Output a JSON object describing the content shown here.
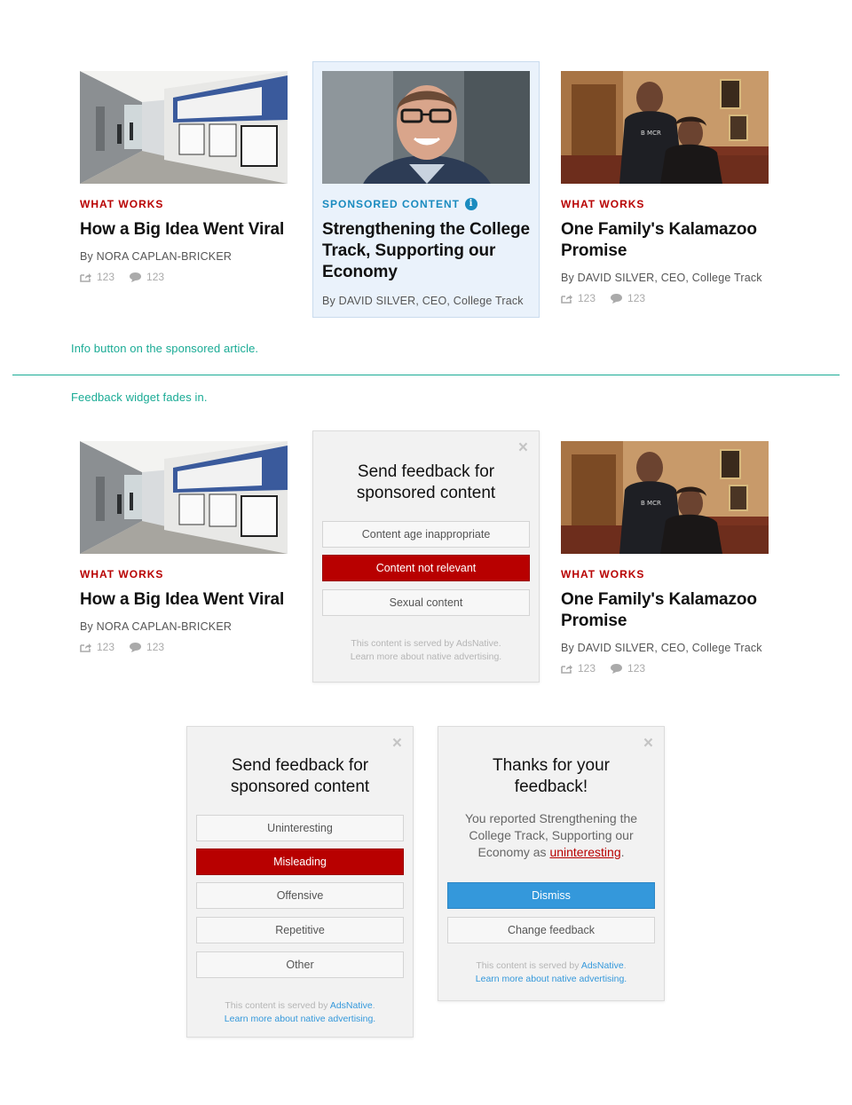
{
  "notes": {
    "info": "Info button on the sponsored article.",
    "feedback": "Feedback widget fades in."
  },
  "articles": {
    "left": {
      "kicker": "WHAT WORKS",
      "headline": "How a Big Idea Went Viral",
      "byline": "By NORA CAPLAN-BRICKER",
      "shares": "123",
      "comments": "123"
    },
    "sponsored": {
      "kicker": "SPONSORED CONTENT",
      "headline": "Strengthening the College Track, Supporting our Economy",
      "byline": "By DAVID SILVER, CEO, College Track"
    },
    "right": {
      "kicker": "WHAT WORKS",
      "headline": "One Family's Kalamazoo Promise",
      "byline": "By DAVID SILVER, CEO, College Track",
      "shares": "123",
      "comments": "123"
    }
  },
  "feedback_widget": {
    "close": "×",
    "title": "Send feedback for sponsored content",
    "options": [
      "Content age inappropriate",
      "Content not relevant",
      "Sexual content"
    ],
    "selected_index": 1,
    "footer_line1": "This content is served by AdsNative.",
    "footer_line2": "Learn more about native advertising."
  },
  "feedback_widget_expanded": {
    "close": "×",
    "title": "Send feedback for sponsored content",
    "options": [
      "Uninteresting",
      "Misleading",
      "Offensive",
      "Repetitive",
      "Other"
    ],
    "selected_index": 1,
    "footer_prefix": "This content is served by ",
    "footer_link": "AdsNative",
    "footer_period": ".",
    "footer_line2": "Learn more about native advertising."
  },
  "thanks_widget": {
    "close": "×",
    "title": "Thanks for your feedback!",
    "message_prefix": "You reported Strengthening the College Track, Supporting our Economy as ",
    "reason": "uninteresting",
    "message_suffix": ".",
    "dismiss": "Dismiss",
    "change": "Change feedback",
    "footer_prefix": "This content is served by ",
    "footer_link": "AdsNative",
    "footer_period": ".",
    "footer_line2": "Learn more about native advertising."
  },
  "colors": {
    "kicker_red": "#b80000",
    "sponsored_blue": "#1a8bbf",
    "note_teal": "#1aab95",
    "primary_blue": "#3498db"
  }
}
